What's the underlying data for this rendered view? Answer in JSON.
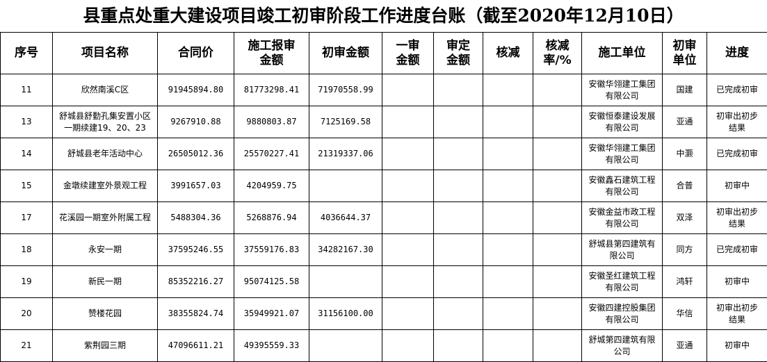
{
  "title": "县重点处重大建设项目竣工初审阶段工作进度台账（截至2020年12月10日）",
  "headers": [
    "序号",
    "项目名称",
    "合同价",
    "施工报审金额",
    "初审金额",
    "一审金额",
    "审定金额",
    "核减",
    "核减率/%",
    "施工单位",
    "初审单位",
    "进度"
  ],
  "rows": [
    {
      "no": "11",
      "name": "欣然南溪C区",
      "contract": "91945894.80",
      "submitted": "81773298.41",
      "preliminary": "71970558.99",
      "first_audit": "",
      "approved": "",
      "reduction": "",
      "rate": "",
      "contractor": "安徽华翎建工集团有限公司",
      "auditor": "国建",
      "progress": "已完成初审"
    },
    {
      "no": "13",
      "name": "舒城县舒勤孔集安置小区一期续建19、20、23",
      "contract": "9267910.88",
      "submitted": "9880803.87",
      "preliminary": "7125169.58",
      "first_audit": "",
      "approved": "",
      "reduction": "",
      "rate": "",
      "contractor": "安徽恒泰建设发展有限公司",
      "auditor": "亚通",
      "progress": "初审出初步结果"
    },
    {
      "no": "14",
      "name": "舒城县老年活动中心",
      "contract": "26505012.36",
      "submitted": "25570227.41",
      "preliminary": "21319337.06",
      "first_audit": "",
      "approved": "",
      "reduction": "",
      "rate": "",
      "contractor": "安徽华翎建工集团有限公司",
      "auditor": "中灏",
      "progress": "已完成初审"
    },
    {
      "no": "15",
      "name": "金墩续建室外景观工程",
      "contract": "3991657.03",
      "submitted": "4204959.75",
      "preliminary": "",
      "first_audit": "",
      "approved": "",
      "reduction": "",
      "rate": "",
      "contractor": "安徽鑫石建筑工程有限公司",
      "auditor": "合普",
      "progress": "初审中"
    },
    {
      "no": "17",
      "name": "花溪园一期室外附属工程",
      "contract": "5488304.36",
      "submitted": "5268876.94",
      "preliminary": "4036644.37",
      "first_audit": "",
      "approved": "",
      "reduction": "",
      "rate": "",
      "contractor": "安徽金益市政工程有限公司",
      "auditor": "双泽",
      "progress": "初审出初步结果"
    },
    {
      "no": "18",
      "name": "永安一期",
      "contract": "37595246.55",
      "submitted": "37559176.83",
      "preliminary": "34282167.30",
      "first_audit": "",
      "approved": "",
      "reduction": "",
      "rate": "",
      "contractor": "舒城县第四建筑有限公司",
      "auditor": "同方",
      "progress": "已完成初审"
    },
    {
      "no": "19",
      "name": "新民一期",
      "contract": "85352216.27",
      "submitted": "95074125.58",
      "preliminary": "",
      "first_audit": "",
      "approved": "",
      "reduction": "",
      "rate": "",
      "contractor": "安徽圣红建筑工程有限公司",
      "auditor": "鸿轩",
      "progress": "初审中"
    },
    {
      "no": "20",
      "name": "赞楼花园",
      "contract": "38355824.74",
      "submitted": "35949921.07",
      "preliminary": "31156100.00",
      "first_audit": "",
      "approved": "",
      "reduction": "",
      "rate": "",
      "contractor": "安徽四建控股集团有限公司",
      "auditor": "华信",
      "progress": "初审出初步结果"
    },
    {
      "no": "21",
      "name": "紫荆园三期",
      "contract": "47096611.21",
      "submitted": "49395559.33",
      "preliminary": "",
      "first_audit": "",
      "approved": "",
      "reduction": "",
      "rate": "",
      "contractor": "舒城第四建筑有限公司",
      "auditor": "亚通",
      "progress": "初审中"
    }
  ],
  "colors": {
    "selected_cell_border": "#2e8b3e",
    "grid": "#000000"
  }
}
